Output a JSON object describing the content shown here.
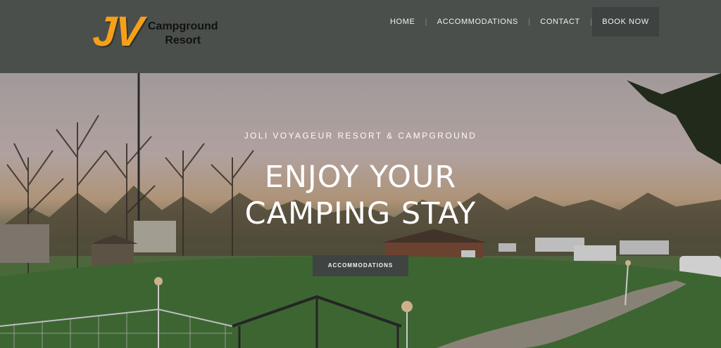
{
  "logo": {
    "mark": "JV",
    "line1": "Campground",
    "line2": "Resort"
  },
  "nav": {
    "items": [
      {
        "label": "HOME"
      },
      {
        "label": "ACCOMMODATIONS"
      },
      {
        "label": "CONTACT"
      },
      {
        "label": "BOOK NOW"
      }
    ],
    "separator": "|"
  },
  "hero": {
    "subtitle": "JOLI VOYAGEUR RESORT & CAMPGROUND",
    "title_line1": "ENJOY YOUR",
    "title_line2": "CAMPING STAY",
    "cta_label": "ACCOMMODATIONS"
  },
  "colors": {
    "header_bg": "#4a4f4c",
    "logo_accent": "#f6a01a",
    "button_bg": "#3f4442"
  }
}
